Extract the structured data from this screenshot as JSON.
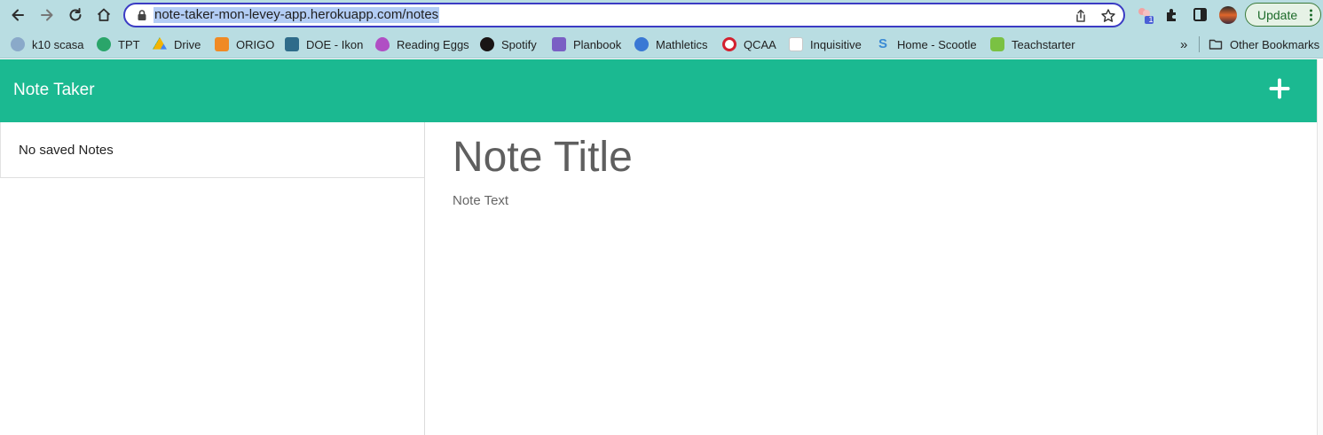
{
  "browser": {
    "url": "note-taker-mon-levey-app.herokuapp.com/notes",
    "update_label": "Update",
    "extension_badge": "1",
    "bookmarks": [
      {
        "label": "k10 scasa",
        "icon": "cloud-icon",
        "color": "#8aa9c9"
      },
      {
        "label": "TPT",
        "icon": "tpt-icon",
        "color": "#2aa56a"
      },
      {
        "label": "Drive",
        "icon": "drive-icon",
        "color": "#f4b400"
      },
      {
        "label": "ORIGO",
        "icon": "origo-icon",
        "color": "#f08a24"
      },
      {
        "label": "DOE - Ikon",
        "icon": "ikon-icon",
        "color": "#2e6b8a"
      },
      {
        "label": "Reading Eggs",
        "icon": "egg-icon",
        "color": "#b04fc4"
      },
      {
        "label": "Spotify",
        "icon": "spotify-icon",
        "color": "#191414"
      },
      {
        "label": "Planbook",
        "icon": "planbook-icon",
        "color": "#7a5fc4"
      },
      {
        "label": "Mathletics",
        "icon": "mathletics-icon",
        "color": "#3a78d4"
      },
      {
        "label": "QCAA",
        "icon": "qcaa-icon",
        "color": "#d3202f"
      },
      {
        "label": "Inquisitive",
        "icon": "inquisitive-icon",
        "color": "#6a3aa8"
      },
      {
        "label": "Home - Scootle",
        "icon": "scootle-icon",
        "color": "#3a8ad4"
      },
      {
        "label": "Teachstarter",
        "icon": "teachstarter-icon",
        "color": "#7ac143"
      }
    ],
    "other_bookmarks": "Other Bookmarks",
    "overflow": "»"
  },
  "app": {
    "title": "Note Taker",
    "sidebar_empty": "No saved Notes",
    "note_title_placeholder": "Note Title",
    "note_text_placeholder": "Note Text",
    "accent_color": "#1bb991"
  }
}
